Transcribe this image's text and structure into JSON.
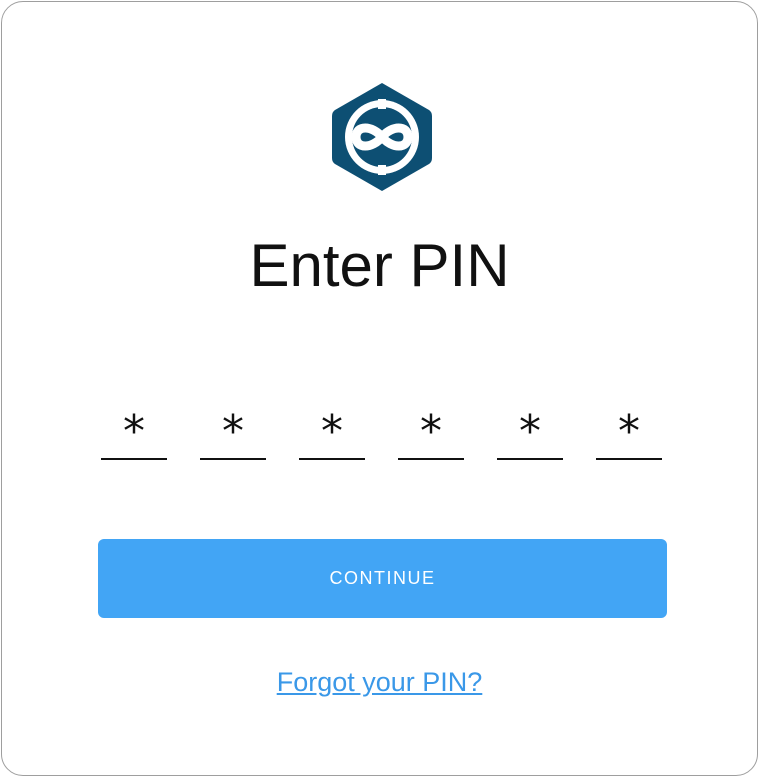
{
  "logo": {
    "icon": "infinity-hexagon-logo",
    "color": "#0d4f73"
  },
  "title": "Enter PIN",
  "pin": {
    "digits": [
      "*",
      "*",
      "*",
      "*",
      "*",
      "*"
    ]
  },
  "continue_button": {
    "label": "CONTINUE",
    "color": "#42a5f5"
  },
  "forgot_link": {
    "label": "Forgot your PIN?",
    "color": "#3a98e8"
  }
}
